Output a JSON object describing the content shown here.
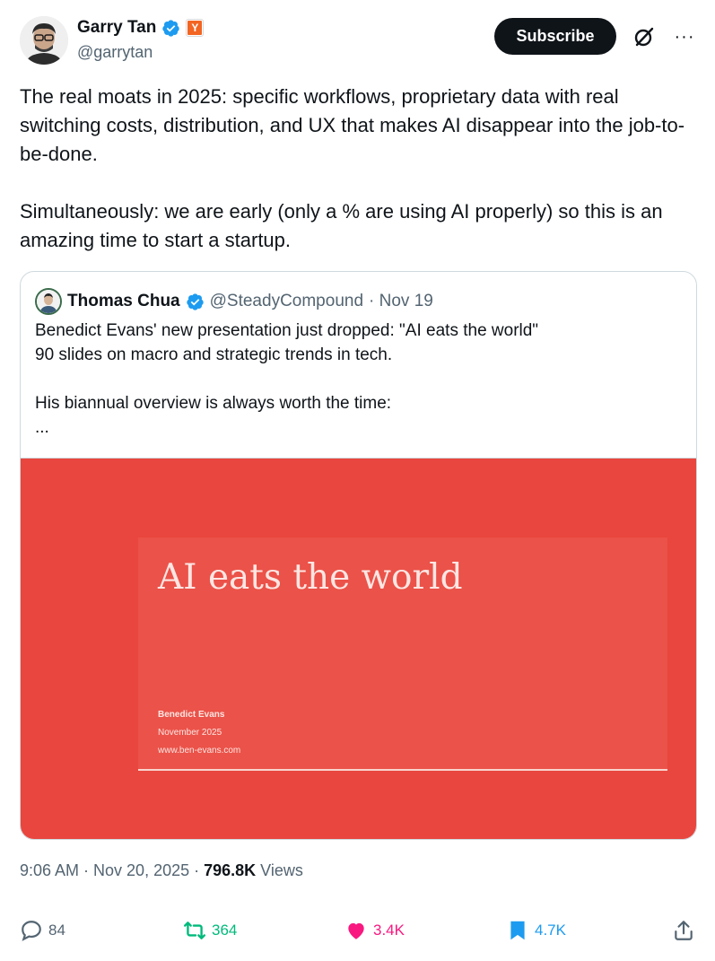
{
  "author": {
    "name": "Garry Tan",
    "handle": "@garrytan",
    "badge_letter": "Y"
  },
  "header": {
    "subscribe_label": "Subscribe",
    "more_label": "···"
  },
  "tweet": {
    "text": "The real moats in 2025: specific workflows, proprietary data with real switching costs, distribution, and UX that makes AI disappear into the job-to-be-done.\n\nSimultaneously: we are early (only a % are using AI properly) so this is an amazing time to start a startup."
  },
  "quote": {
    "name": "Thomas Chua",
    "handle": "@SteadyCompound",
    "date": "· Nov 19",
    "text": "Benedict Evans' new presentation just dropped: \"AI eats the world\"\n90 slides on macro and strategic trends in tech.\n\nHis biannual overview is always worth the time:\n...",
    "slide": {
      "title": "AI eats the world",
      "author": "Benedict Evans",
      "date": "November 2025",
      "url": "www.ben-evans.com"
    }
  },
  "meta": {
    "time": "9:06 AM · Nov 20, 2025 · ",
    "views_count": "796.8K",
    "views_label": " Views"
  },
  "actions": {
    "replies": "84",
    "reposts": "364",
    "likes": "3.4K",
    "bookmarks": "4.7K"
  },
  "colors": {
    "repost": "#00ba7c",
    "like": "#f91880",
    "bookmark": "#1d9bf0",
    "slide_bg": "#e8463e"
  }
}
